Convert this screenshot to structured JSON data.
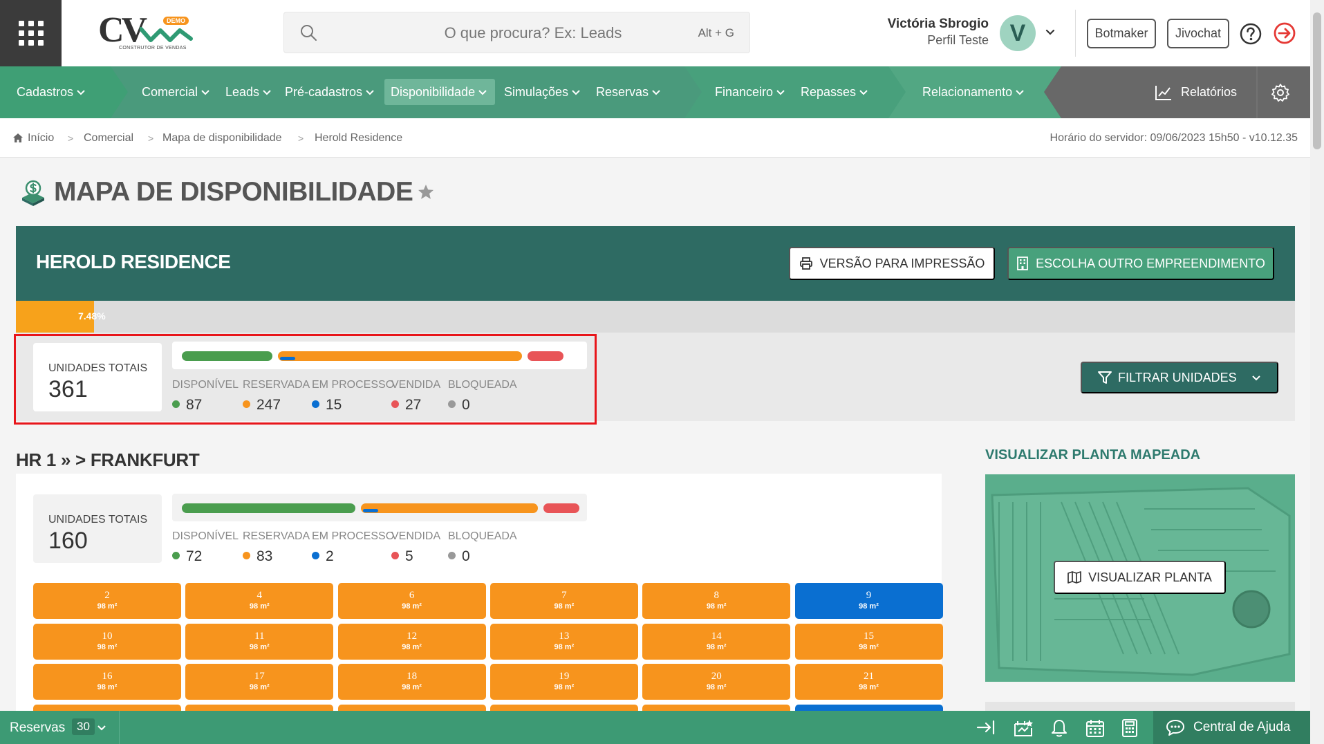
{
  "header": {
    "logo_text": "CV",
    "logo_badge": "DEMO",
    "logo_tagline": "CONSTRUTOR DE VENDAS",
    "search_placeholder": "O que procura? Ex: Leads",
    "search_shortcut": "Alt + G",
    "user_name": "Victória Sbrogio",
    "user_profile": "Perfil Teste",
    "avatar_initial": "V",
    "botmaker_label": "Botmaker",
    "jivochat_label": "Jivochat"
  },
  "nav": {
    "items": [
      {
        "label": "Cadastros"
      },
      {
        "label": "Comercial"
      },
      {
        "label": "Leads"
      },
      {
        "label": "Pré-cadastros"
      },
      {
        "label": "Disponibilidade"
      },
      {
        "label": "Simulações"
      },
      {
        "label": "Reservas"
      },
      {
        "label": "Financeiro"
      },
      {
        "label": "Repasses"
      },
      {
        "label": "Relacionamento"
      }
    ],
    "reports_label": "Relatórios",
    "active": "Disponibilidade"
  },
  "breadcrumb": {
    "items": [
      "Início",
      "Comercial",
      "Mapa de disponibilidade",
      "Herold Residence"
    ],
    "server_time": "Horário do servidor: 09/06/2023 15h50 - v10.12.35"
  },
  "page": {
    "title": "MAPA DE DISPONIBILIDADE"
  },
  "project": {
    "name": "HEROLD RESIDENCE",
    "print_label": "VERSÃO PARA IMPRESSÃO",
    "choose_label": "ESCOLHA OUTRO EMPREENDIMENTO",
    "progress_percent": 7.48,
    "progress_label": "7.48%",
    "filter_label": "FILTRAR UNIDADES"
  },
  "summary": {
    "total_label": "UNIDADES TOTAIS",
    "total": "361",
    "statuses": [
      {
        "label": "DISPONÍVEL",
        "value": "87"
      },
      {
        "label": "RESERVADA",
        "value": "247"
      },
      {
        "label": "EM PROCESSO",
        "value": "15"
      },
      {
        "label": "VENDIDA",
        "value": "27"
      },
      {
        "label": "BLOQUEADA",
        "value": "0"
      }
    ]
  },
  "block": {
    "title": "HR 1 » > FRANKFURT",
    "total_label": "UNIDADES TOTAIS",
    "total": "160",
    "statuses": [
      {
        "label": "DISPONÍVEL",
        "value": "72"
      },
      {
        "label": "RESERVADA",
        "value": "83"
      },
      {
        "label": "EM PROCESSO",
        "value": "2"
      },
      {
        "label": "VENDIDA",
        "value": "5"
      },
      {
        "label": "BLOQUEADA",
        "value": "0"
      }
    ],
    "units": [
      {
        "number": "2",
        "area": "98 m²",
        "status": "reservada"
      },
      {
        "number": "4",
        "area": "98 m²",
        "status": "reservada"
      },
      {
        "number": "6",
        "area": "98 m²",
        "status": "reservada"
      },
      {
        "number": "7",
        "area": "98 m²",
        "status": "reservada"
      },
      {
        "number": "8",
        "area": "98 m²",
        "status": "reservada"
      },
      {
        "number": "9",
        "area": "98 m²",
        "status": "em-processo"
      },
      {
        "number": "10",
        "area": "98 m²",
        "status": "reservada"
      },
      {
        "number": "11",
        "area": "98 m²",
        "status": "reservada"
      },
      {
        "number": "12",
        "area": "98 m²",
        "status": "reservada"
      },
      {
        "number": "13",
        "area": "98 m²",
        "status": "reservada"
      },
      {
        "number": "14",
        "area": "98 m²",
        "status": "reservada"
      },
      {
        "number": "15",
        "area": "98 m²",
        "status": "reservada"
      },
      {
        "number": "16",
        "area": "98 m²",
        "status": "reservada"
      },
      {
        "number": "17",
        "area": "98 m²",
        "status": "reservada"
      },
      {
        "number": "18",
        "area": "98 m²",
        "status": "reservada"
      },
      {
        "number": "19",
        "area": "98 m²",
        "status": "reservada"
      },
      {
        "number": "20",
        "area": "98 m²",
        "status": "reservada"
      },
      {
        "number": "21",
        "area": "98 m²",
        "status": "reservada"
      }
    ]
  },
  "plan": {
    "title": "VISUALIZAR PLANTA MAPEADA",
    "button_label": "VISUALIZAR PLANTA"
  },
  "bottom": {
    "reservations_label": "Reservas",
    "reservations_count": "30",
    "help_label": "Central de Ajuda"
  },
  "colors": {
    "disponivel": "#4a9d4e",
    "reservada": "#f7941d",
    "em_processo": "#0a6fd1",
    "vendida": "#e85457",
    "bloqueada": "#999999",
    "brand_dark": "#2e6b63",
    "brand_green": "#4a9a7c"
  }
}
